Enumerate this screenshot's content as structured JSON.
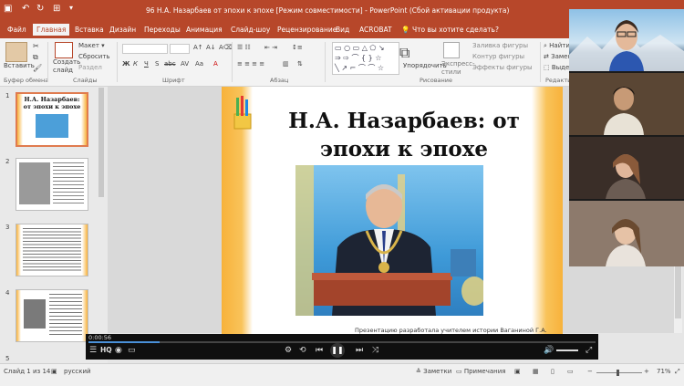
{
  "window": {
    "title": "96 Н.А. Назарбаев от эпохи к эпохе [Режим совместимости] - PowerPoint (Сбой активации продукта)",
    "quick_access": [
      "save-icon",
      "undo-icon",
      "redo-icon",
      "present-icon"
    ]
  },
  "tabs": [
    "Файл",
    "Главная",
    "Вставка",
    "Дизайн",
    "Переходы",
    "Анимация",
    "Слайд-шоу",
    "Рецензирование",
    "Вид",
    "ACROBAT"
  ],
  "tell_me": "Что вы хотите сделать?",
  "ribbon": {
    "paste": "Вставить",
    "new_slide": "Создать\nслайд",
    "layout": "Макет",
    "reset": "Сбросить",
    "section": "Раздел",
    "font_style_buttons": [
      "Ж",
      "К",
      "Ч",
      "S",
      "abc",
      "AV",
      "Аа",
      "А"
    ],
    "arrange": "Упорядочить",
    "quick_styles": "Экспресс-\nстили",
    "shape_fill": "Заливка фигуры",
    "shape_outline": "Контур фигуры",
    "shape_effects": "Эффекты фигуры",
    "find": "Найти",
    "replace": "Заменить",
    "select": "Выделить",
    "groups": [
      "Буфер обмена",
      "Слайды",
      "Шрифт",
      "Абзац",
      "Рисование",
      "Редактир"
    ]
  },
  "slides_pane": {
    "numbers": [
      "1",
      "2",
      "3",
      "4",
      "5"
    ],
    "slide1_title": "Н.А. Назарбаев: от эпохи к эпохе"
  },
  "slide": {
    "title_line1": "Н.А. Назарбаев: от",
    "title_line2": "эпохи к эпохе",
    "caption": "Презентацию разработала учителем истории Ваганиной Г.А."
  },
  "video": {
    "time": "0:00:56",
    "progress": 0.14,
    "quality": "HQ"
  },
  "status": {
    "slide_info": "Слайд 1 из 14",
    "language": "русский",
    "notes": "Заметки",
    "comments": "Примечания",
    "zoom": "71%"
  },
  "colors": {
    "accent": "#b7472a",
    "slide_border": "#f7b23b",
    "thumb_select": "#e07b4f"
  }
}
